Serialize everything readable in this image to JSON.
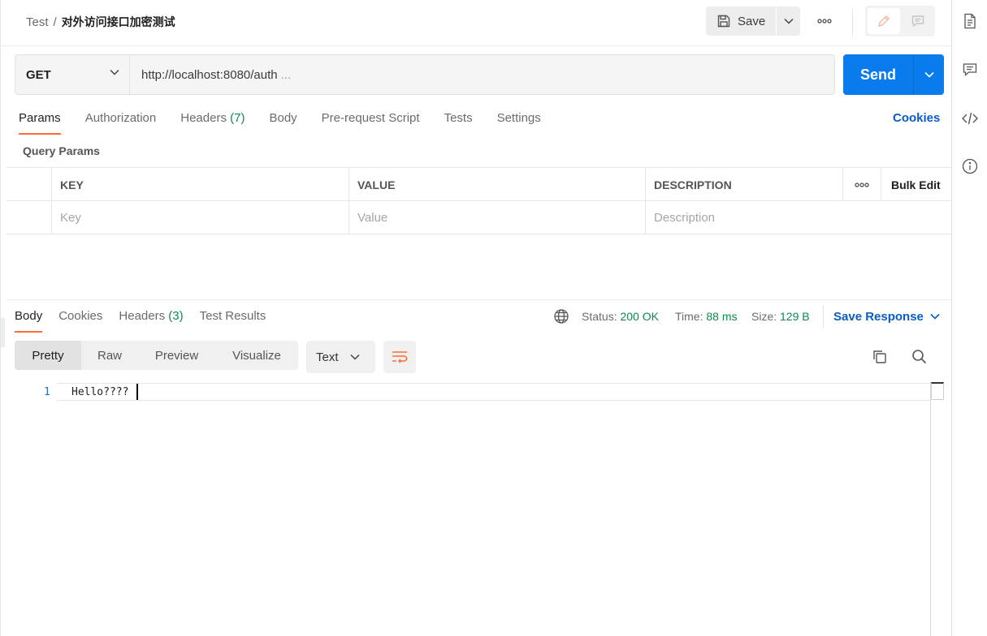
{
  "header": {
    "breadcrumb_parent": "Test",
    "breadcrumb_sep": "/",
    "title": "对外访问接口加密测试",
    "save_label": "Save"
  },
  "request": {
    "method": "GET",
    "url": "http://localhost:8080/auth",
    "url_ellipsis": "...",
    "send_label": "Send"
  },
  "request_tabs": {
    "params": "Params",
    "authorization": "Authorization",
    "headers": "Headers",
    "headers_count": "(7)",
    "body": "Body",
    "prerequest": "Pre-request Script",
    "tests": "Tests",
    "settings": "Settings",
    "cookies": "Cookies"
  },
  "query_params": {
    "label": "Query Params",
    "columns": {
      "key": "KEY",
      "value": "VALUE",
      "description": "DESCRIPTION"
    },
    "bulk_edit": "Bulk Edit",
    "placeholders": {
      "key": "Key",
      "value": "Value",
      "description": "Description"
    }
  },
  "response_tabs": {
    "body": "Body",
    "cookies": "Cookies",
    "headers": "Headers",
    "headers_count": "(3)",
    "test_results": "Test Results"
  },
  "response_status": {
    "status_label": "Status:",
    "status_value": "200 OK",
    "time_label": "Time:",
    "time_value": "88 ms",
    "size_label": "Size:",
    "size_value": "129 B",
    "save_response": "Save Response"
  },
  "view_modes": {
    "pretty": "Pretty",
    "raw": "Raw",
    "preview": "Preview",
    "visualize": "Visualize",
    "format": "Text"
  },
  "editor": {
    "line_number": "1",
    "content": "Hello????"
  },
  "colors": {
    "accent_orange": "#ff6c37",
    "send_blue": "#097bed",
    "link_blue": "#0b5cc4",
    "success_green": "#0b8a4b"
  }
}
